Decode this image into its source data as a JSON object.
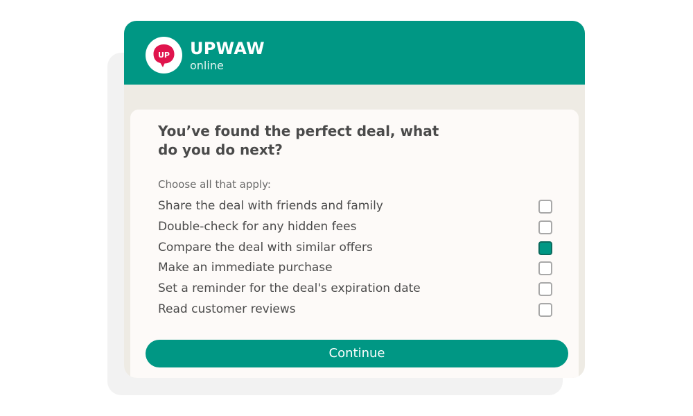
{
  "header": {
    "app_name": "UPWAW",
    "status": "online",
    "logo_text": "UP",
    "logo_icon": "speech-bubble-logo"
  },
  "survey": {
    "question": "You’ve found the perfect deal, what do you do next?",
    "instruction": "Choose all that apply:",
    "options": [
      {
        "label": "Share the deal with friends and family",
        "checked": false
      },
      {
        "label": "Double-check for any hidden fees",
        "checked": false
      },
      {
        "label": "Compare the deal with similar offers",
        "checked": true
      },
      {
        "label": "Make an immediate purchase",
        "checked": false
      },
      {
        "label": "Set a reminder for the deal's expiration date",
        "checked": false
      },
      {
        "label": "Read customer reviews",
        "checked": false
      }
    ],
    "continue_label": "Continue"
  },
  "colors": {
    "brand": "#009784",
    "logo_red": "#e0144d",
    "background": "#eeebe4"
  }
}
